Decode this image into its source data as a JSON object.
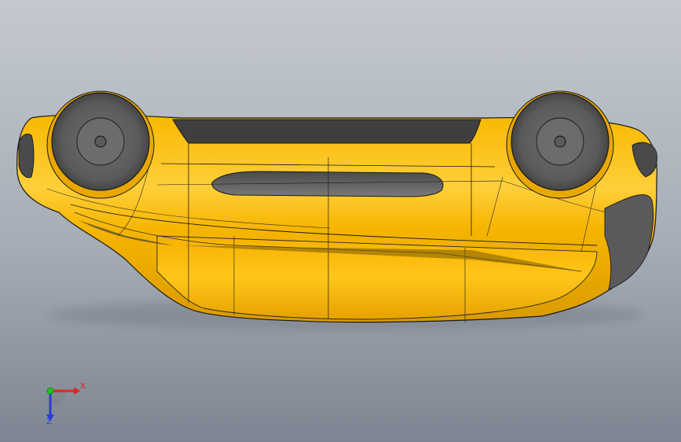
{
  "viewport": {
    "background_top": "#c3c8ce",
    "background_bottom": "#7e8793",
    "model_color": "#f5b800",
    "model_highlight": "#ffd949",
    "model_shadow": "#c98a00",
    "trim_color": "#5e5e5e",
    "edge_color": "#1a1a1a"
  },
  "triad": {
    "x_label": "X",
    "z_label": "Z",
    "x_color": "#e02424",
    "y_color": "#22c022",
    "z_color": "#2a3bd6"
  }
}
